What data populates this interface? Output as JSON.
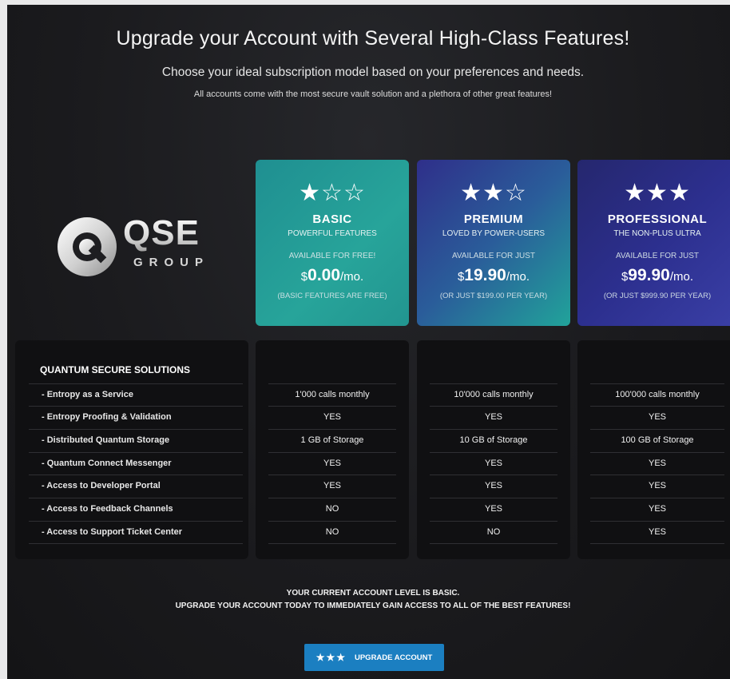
{
  "header": {
    "title": "Upgrade your Account with Several High-Class Features!",
    "subtitle": "Choose your ideal subscription model based on your preferences and needs.",
    "subtitle2": "All accounts come with the most secure vault solution and a plethora of other great features!"
  },
  "logo": {
    "mark": "QSE",
    "sub": "GROUP"
  },
  "plans": [
    {
      "stars": "★☆☆",
      "name": "BASIC",
      "tagline": "POWERFUL FEATURES",
      "availability": "AVAILABLE FOR FREE!",
      "currency": "$",
      "price": "0.00",
      "period": "/mo.",
      "note": "(BASIC FEATURES ARE FREE)"
    },
    {
      "stars": "★★☆",
      "name": "PREMIUM",
      "tagline": "LOVED BY POWER-USERS",
      "availability": "AVAILABLE FOR JUST",
      "currency": "$",
      "price": "19.90",
      "period": "/mo.",
      "note": "(OR JUST $199.00 PER YEAR)"
    },
    {
      "stars": "★★★",
      "name": "PROFESSIONAL",
      "tagline": "THE NON-PLUS ULTRA",
      "availability": "AVAILABLE FOR JUST",
      "currency": "$",
      "price": "99.90",
      "period": "/mo.",
      "note": "(OR JUST $999.90 PER YEAR)"
    }
  ],
  "features": {
    "heading": "QUANTUM SECURE SOLUTIONS",
    "rows": [
      "- Entropy as a Service",
      "- Entropy Proofing & Validation",
      "- Distributed Quantum Storage",
      "- Quantum Connect Messenger",
      "- Access to Developer Portal",
      "- Access to Feedback Channels",
      "- Access to Support Ticket Center"
    ]
  },
  "matrix": [
    [
      "1'000 calls monthly",
      "YES",
      "1 GB of Storage",
      "YES",
      "YES",
      "NO",
      "NO"
    ],
    [
      "10'000 calls monthly",
      "YES",
      "10 GB of Storage",
      "YES",
      "YES",
      "YES",
      "NO"
    ],
    [
      "100'000 calls monthly",
      "YES",
      "100 GB of Storage",
      "YES",
      "YES",
      "YES",
      "YES"
    ]
  ],
  "footer": {
    "line1": "YOUR CURRENT ACCOUNT LEVEL IS BASIC.",
    "line2": "UPGRADE YOUR ACCOUNT TODAY TO IMMEDIATELY GAIN ACCESS TO ALL OF THE BEST FEATURES!",
    "button_stars": "★★★",
    "button_label": "UPGRADE ACCOUNT"
  },
  "colors": {
    "basic": "#229590",
    "premium": "#2a5d9a",
    "professional": "#2c2f8e",
    "button": "#1b7fc1"
  }
}
